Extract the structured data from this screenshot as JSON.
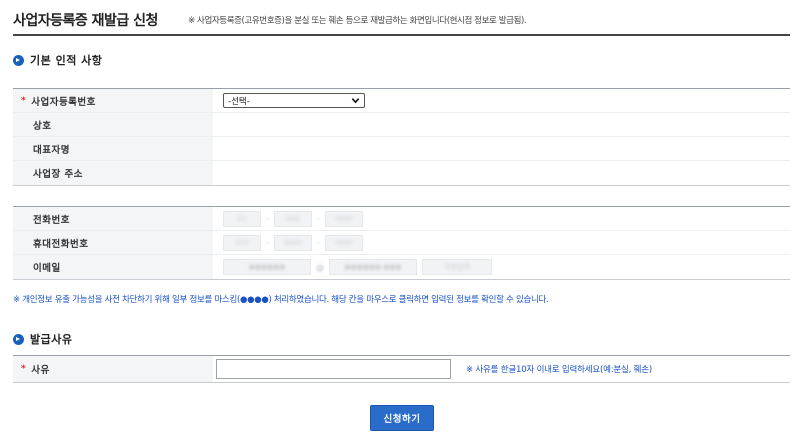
{
  "header": {
    "title": "사업자등록증 재발급 신청",
    "description": "※ 사업자등록증(고유번호증)을 분실 또는 훼손 등으로 재발급하는 화면입니다(현시점 정보로 발급됨)."
  },
  "basic_section": {
    "title": "기본 인적 사항",
    "required_mark": "*",
    "rows": [
      {
        "label": "사업자등록번호",
        "select_value": "-선택-"
      },
      {
        "label": "상호"
      },
      {
        "label": "대표자명"
      },
      {
        "label": "사업장 주소"
      }
    ]
  },
  "contact_section": {
    "rows": [
      {
        "label": "전화번호",
        "masked": [
          "02",
          "000",
          "0000"
        ]
      },
      {
        "label": "휴대전화번호",
        "masked": [
          "010",
          "0000",
          "0000"
        ]
      },
      {
        "label": "이메일",
        "masked": [
          "●●●●●●",
          "●●●●●●.●●●",
          "직접입력"
        ]
      }
    ]
  },
  "privacy_notice": "※ 개인정보 유출 가능성을 사전 차단하기 위해 일부 정보를 마스킹(●●●●) 처리하였습니다. 해당 칸을 마우스로 클릭하면 입력된 정보를 확인할 수 있습니다.",
  "reason_section": {
    "title": "발급사유",
    "row_label": "사유",
    "input_value": "",
    "hint": "※ 사유를 한글10자 이내로 입력하세요(예:분실, 훼손)"
  },
  "submit_label": "신청하기",
  "colors": {
    "accent": "#2a6cc9",
    "notice": "#1a52c4",
    "required": "#d9262d"
  }
}
